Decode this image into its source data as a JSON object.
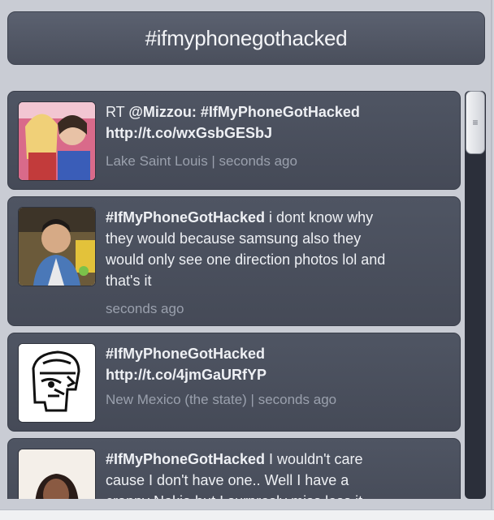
{
  "header": {
    "title": "#ifmyphonegothacked"
  },
  "tweets": [
    {
      "line1_prefix": "RT ",
      "line1_bold": "@Mizzou: #IfMyPhoneGotHacked",
      "line2_bold": "http://t.co/wxGsbGESbJ",
      "meta": "Lake Saint Louis | seconds ago"
    },
    {
      "bold": "#IfMyPhoneGotHacked",
      "rest_line1": " i dont know why",
      "line2": "they would because samsung also they",
      "line3": "would only see one direction photos lol and",
      "line4": "that's it",
      "meta": "seconds ago"
    },
    {
      "line1_bold": "#IfMyPhoneGotHacked",
      "line2_bold": "http://t.co/4jmGaURfYP",
      "meta": "New Mexico (the state) | seconds ago"
    },
    {
      "bold": "#IfMyPhoneGotHacked",
      "rest_line1": " I wouldn't care",
      "line2": "cause I don't have one.. Well I have a",
      "line3": "crappy Nokia but I surprosly miss loss it"
    }
  ],
  "scrollbar": {
    "grip_glyph": "≡"
  }
}
